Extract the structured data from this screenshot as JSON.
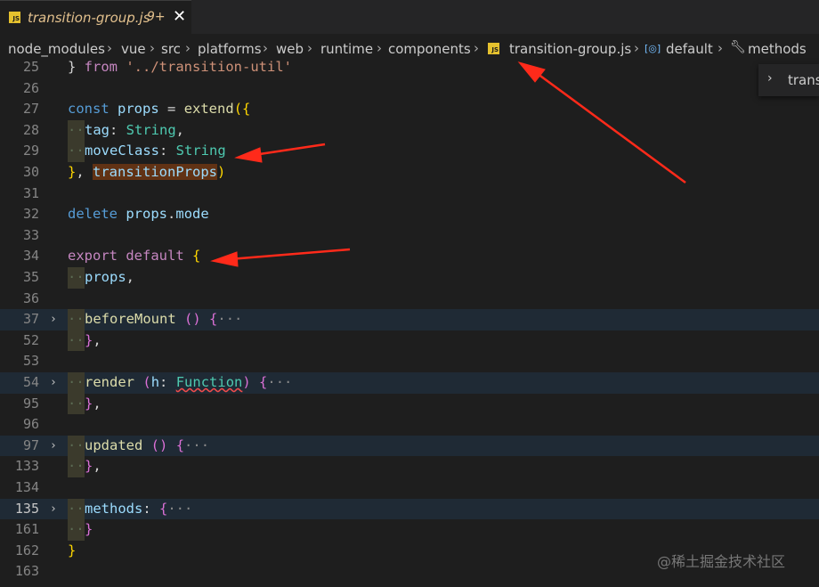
{
  "tab": {
    "filename": "transition-group.js",
    "problems": "9+",
    "close_glyph": "✕",
    "icon": "js-icon"
  },
  "breadcrumb": {
    "items": [
      "node_modules",
      "vue",
      "src",
      "platforms",
      "web",
      "runtime",
      "components",
      "transition-group.js",
      "default",
      "methods"
    ],
    "separator": "›"
  },
  "peek": {
    "label": "trans"
  },
  "code": {
    "lines": [
      {
        "n": "25",
        "parts": [
          [
            "p",
            "} "
          ],
          [
            "kw2",
            "from"
          ],
          [
            "p",
            " "
          ],
          [
            "str",
            "'../transition-util'"
          ]
        ]
      },
      {
        "n": "26",
        "parts": []
      },
      {
        "n": "27",
        "parts": [
          [
            "kw",
            "const"
          ],
          [
            "p",
            " "
          ],
          [
            "var",
            "props"
          ],
          [
            "p",
            " = "
          ],
          [
            "fn",
            "extend"
          ],
          [
            "brk1",
            "({"
          ]
        ]
      },
      {
        "n": "28",
        "indent": 1,
        "parts": [
          [
            "var",
            "tag"
          ],
          [
            "p",
            ": "
          ],
          [
            "type",
            "String"
          ],
          [
            "p",
            ","
          ]
        ]
      },
      {
        "n": "29",
        "indent": 1,
        "parts": [
          [
            "var",
            "moveClass"
          ],
          [
            "p",
            ": "
          ],
          [
            "type",
            "String"
          ]
        ]
      },
      {
        "n": "30",
        "parts": [
          [
            "brk1",
            "}"
          ],
          [
            "p",
            ", "
          ],
          [
            "tpvar",
            "transitionProps"
          ],
          [
            "brk1",
            ")"
          ]
        ]
      },
      {
        "n": "31",
        "parts": []
      },
      {
        "n": "32",
        "parts": [
          [
            "kw",
            "delete"
          ],
          [
            "p",
            " "
          ],
          [
            "var",
            "props"
          ],
          [
            "p",
            "."
          ],
          [
            "var",
            "mode"
          ]
        ]
      },
      {
        "n": "33",
        "parts": []
      },
      {
        "n": "34",
        "parts": [
          [
            "kw2",
            "export"
          ],
          [
            "p",
            " "
          ],
          [
            "kw2",
            "default"
          ],
          [
            "p",
            " "
          ],
          [
            "brk1",
            "{"
          ]
        ]
      },
      {
        "n": "35",
        "indent": 1,
        "parts": [
          [
            "var",
            "props"
          ],
          [
            "p",
            ","
          ]
        ]
      },
      {
        "n": "36",
        "parts": []
      },
      {
        "n": "37",
        "fold": true,
        "hl": true,
        "indent": 1,
        "parts": [
          [
            "fn",
            "beforeMount"
          ],
          [
            "p",
            " "
          ],
          [
            "brk2",
            "()"
          ],
          [
            "p",
            " "
          ],
          [
            "brk2",
            "{"
          ],
          [
            "dots",
            "···"
          ]
        ]
      },
      {
        "n": "52",
        "indent": 1,
        "parts": [
          [
            "brk2",
            "}"
          ],
          [
            "p",
            ","
          ]
        ]
      },
      {
        "n": "53",
        "parts": []
      },
      {
        "n": "54",
        "fold": true,
        "hl": true,
        "indent": 1,
        "parts": [
          [
            "fn",
            "render"
          ],
          [
            "p",
            " "
          ],
          [
            "brk2",
            "("
          ],
          [
            "var",
            "h"
          ],
          [
            "p",
            ": "
          ],
          [
            "sqtype",
            "Function"
          ],
          [
            "brk2",
            ")"
          ],
          [
            "p",
            " "
          ],
          [
            "brk2",
            "{"
          ],
          [
            "dots",
            "···"
          ]
        ]
      },
      {
        "n": "95",
        "indent": 1,
        "parts": [
          [
            "brk2",
            "}"
          ],
          [
            "p",
            ","
          ]
        ]
      },
      {
        "n": "96",
        "parts": []
      },
      {
        "n": "97",
        "fold": true,
        "hl": true,
        "indent": 1,
        "parts": [
          [
            "fn",
            "updated"
          ],
          [
            "p",
            " "
          ],
          [
            "brk2",
            "()"
          ],
          [
            "p",
            " "
          ],
          [
            "brk2",
            "{"
          ],
          [
            "dots",
            "···"
          ]
        ]
      },
      {
        "n": "133",
        "indent": 1,
        "parts": [
          [
            "brk2",
            "}"
          ],
          [
            "p",
            ","
          ]
        ]
      },
      {
        "n": "134",
        "parts": []
      },
      {
        "n": "135",
        "fold": true,
        "hl": true,
        "active": true,
        "indent": 1,
        "parts": [
          [
            "var",
            "methods"
          ],
          [
            "p",
            ": "
          ],
          [
            "brk2",
            "{"
          ],
          [
            "dots",
            "···"
          ]
        ]
      },
      {
        "n": "161",
        "indent": 1,
        "parts": [
          [
            "brk2",
            "}"
          ]
        ]
      },
      {
        "n": "162",
        "parts": [
          [
            "brk1",
            "}"
          ]
        ]
      },
      {
        "n": "163",
        "parts": []
      }
    ]
  },
  "watermark": "@稀土掘金技术社区",
  "colors": {
    "arrow": "#ff2a1a",
    "editor_bg": "#1e1e1e"
  }
}
